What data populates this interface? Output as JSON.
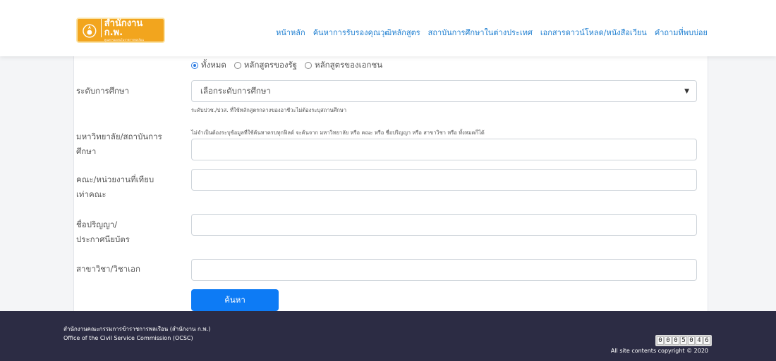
{
  "logo": {
    "title": "สำนักงาน ก.พ.",
    "subtitle": "คุณค่าของคนในราชการพลเรือน"
  },
  "nav": [
    "หน้าหลัก",
    "ค้นหาการรับรองคุณวุฒิหลักสูตร",
    "สถาบันการศึกษาในต่างประเทศ",
    "เอกสารดาวน์โหลด/หนังสือเวียน",
    "คำถามที่พบบ่อย"
  ],
  "radios": [
    {
      "label": "ทั้งหมด",
      "checked": true
    },
    {
      "label": "หลักสูตรของรัฐ",
      "checked": false
    },
    {
      "label": "หลักสูตรของเอกชน",
      "checked": false
    }
  ],
  "fields": {
    "level": {
      "label": "ระดับการศึกษา",
      "value": "เลือกระดับการศึกษา",
      "help": "ระดับปวช./ปวส. ที่ใช้หลักสูตรกลางของอาชีวะไม่ต้องระบุสถานศึกษา"
    },
    "university": {
      "label_1": "มหาวิทยาลัย/สถาบันการ",
      "label_2": "ศึกษา",
      "help": "ไม่จำเป็นต้องระบุข้อมูลที่ใช้ค้นหาครบทุกฟิลด์ จะค้นจาก มหาวิทยาลัย หรือ คณะ หรือ ชื่อปริญญา หรือ สาขาวิชา หรือ ทั้งหมดก็ได้",
      "value": ""
    },
    "faculty": {
      "label_1": "คณะ/หน่วยงานที่เทียบ",
      "label_2": "เท่าคณะ",
      "value": ""
    },
    "degree": {
      "label_1": "ชื่อปริญญา/",
      "label_2": "ประกาศนียบัตร",
      "value": ""
    },
    "major": {
      "label": "สาขาวิชา/วิชาเอก",
      "value": ""
    }
  },
  "search_button": "ค้นหา",
  "footer": {
    "line1": "สำนักงานคณะกรรมการข้าราชการพลเรือน (สำนักงาน ก.พ.)",
    "line2": "Office of the Civil Service Commission (OCSC)",
    "counter_digits": [
      "0",
      "0",
      "0",
      "5",
      "0",
      "4",
      "6"
    ],
    "copyright": "All site contents copyright © 2020"
  },
  "colors": {
    "accent": "#0d7bf5",
    "nav_link": "#1f7fd1",
    "logo_bg": "#f2a51e",
    "footer_bg": "#2c2c44"
  }
}
